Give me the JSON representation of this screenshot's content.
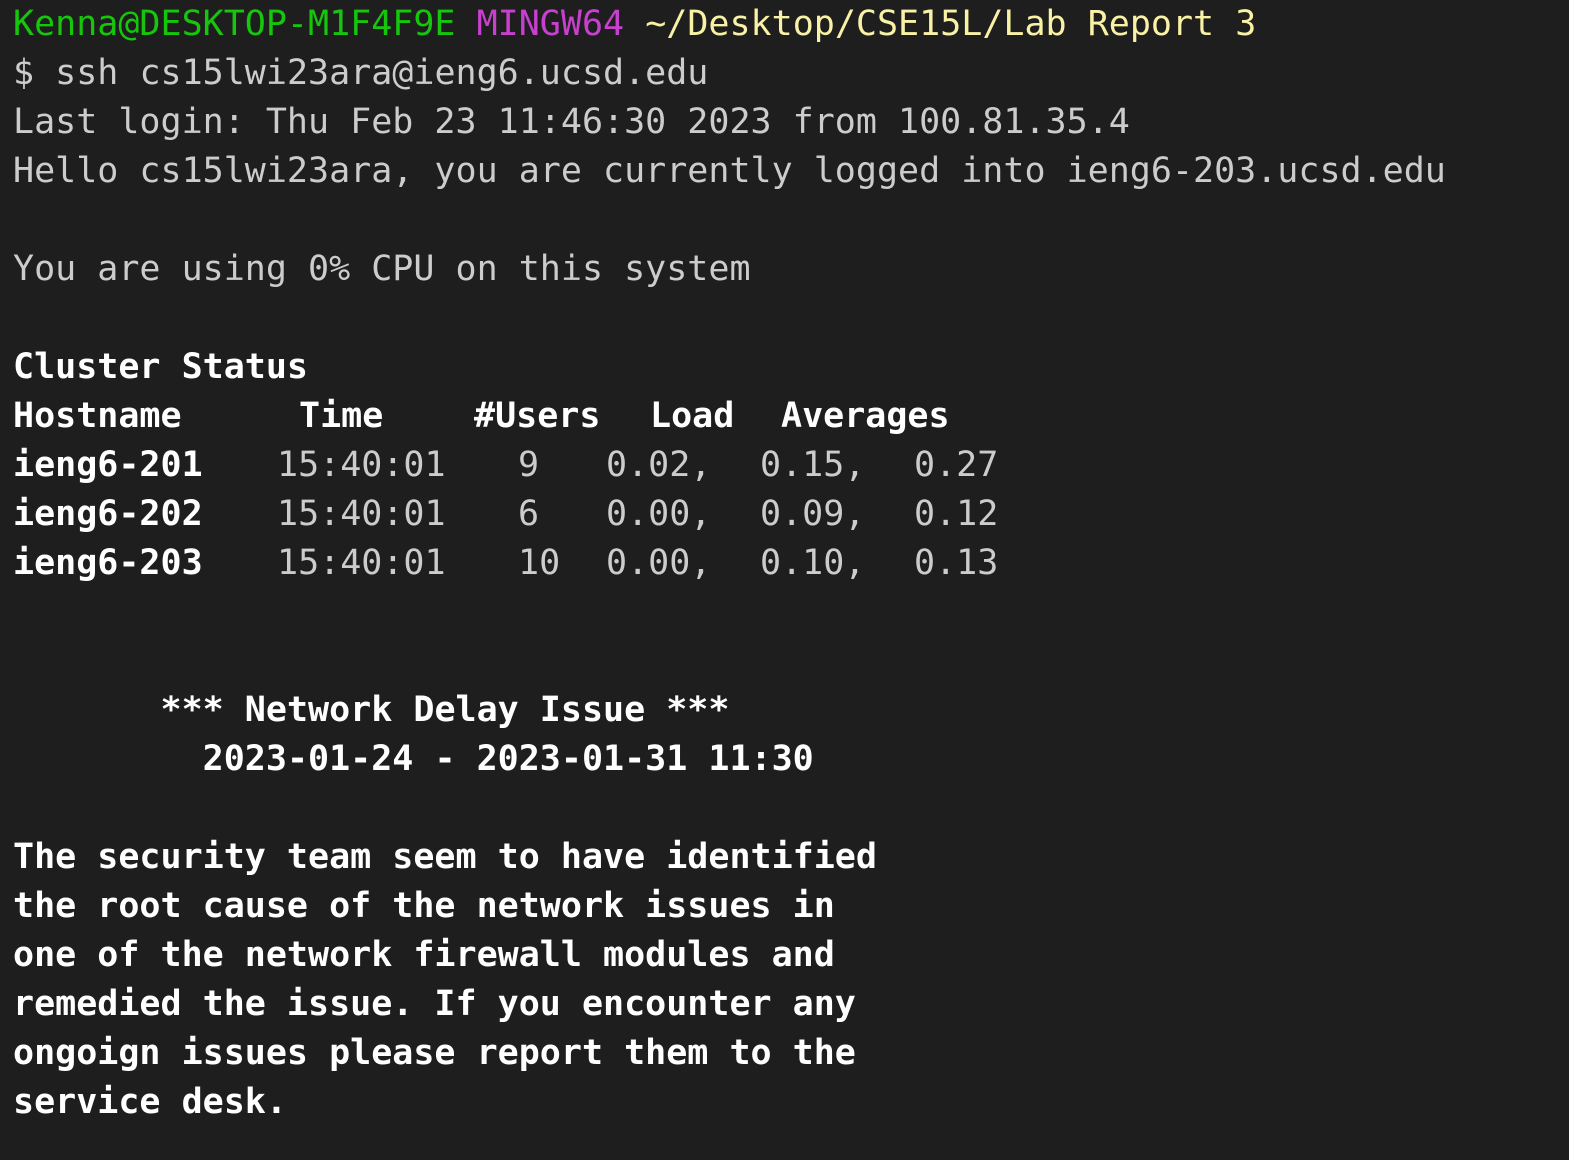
{
  "prompt": {
    "user_host": "Kenna@DESKTOP-M1F4F9E",
    "shell": "MINGW64",
    "cwd": "~/Desktop/CSE15L/Lab Report 3",
    "symbol": "$",
    "command": "ssh cs15lwi23ara@ieng6.ucsd.edu"
  },
  "login": {
    "last_login": "Last login: Thu Feb 23 11:46:30 2023 from 100.81.35.4",
    "hello": "Hello cs15lwi23ara, you are currently logged into ieng6-203.ucsd.edu",
    "cpu": "You are using 0% CPU on this system"
  },
  "cluster": {
    "title": "Cluster Status",
    "headers": {
      "hostname": "Hostname",
      "time": "Time",
      "users": "#Users",
      "load": "Load",
      "averages": "Averages"
    },
    "rows": [
      {
        "host": "ieng6-201",
        "time": "15:40:01",
        "users": "9",
        "l1": "0.02,",
        "l5": "0.15,",
        "l15": "0.27"
      },
      {
        "host": "ieng6-202",
        "time": "15:40:01",
        "users": "6",
        "l1": "0.00,",
        "l5": "0.09,",
        "l15": "0.12"
      },
      {
        "host": "ieng6-203",
        "time": "15:40:01",
        "users": "10",
        "l1": "0.00,",
        "l5": "0.10,",
        "l15": "0.13"
      }
    ]
  },
  "notice": {
    "title": "*** Network Delay Issue ***",
    "dates": "2023-01-24 - 2023-01-31 11:30",
    "body": [
      "The security team seem to have identified",
      "the root cause of the network issues in",
      "one of the network firewall modules and",
      "remedied the issue. If you encounter any",
      "ongoign issues please report them to the",
      "service desk."
    ]
  }
}
